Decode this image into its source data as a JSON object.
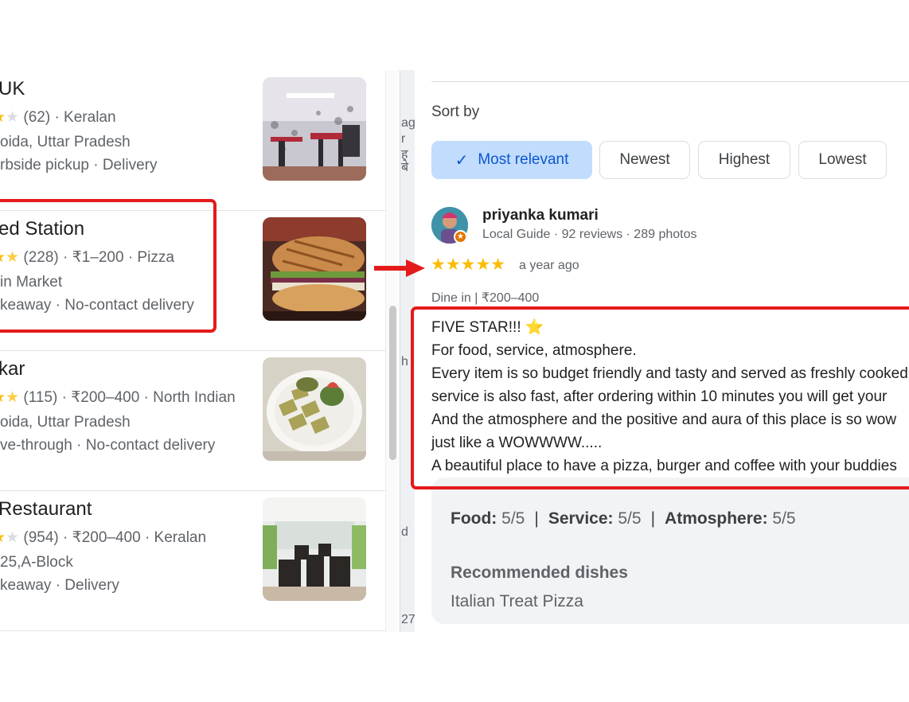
{
  "results": [
    {
      "name": "UK",
      "stars": [
        1,
        0.4,
        0
      ],
      "rating_count": "(62)",
      "meta_rest": " · Keralan",
      "address": "oida, Uttar Pradesh",
      "services": "rbside pickup · Delivery"
    },
    {
      "name": "ed Station",
      "stars": [
        1,
        0.6
      ],
      "rating_count": "(228)",
      "meta_rest": " · ₹1–200 · Pizza",
      "address": "in Market",
      "services": "keaway · No-contact delivery"
    },
    {
      "name": "kar",
      "stars": [
        1,
        0.6
      ],
      "rating_count": "(115)",
      "meta_rest": " · ₹200–400 · North Indian",
      "address": "oida, Uttar Pradesh",
      "services": "ve-through · No-contact delivery"
    },
    {
      "name": "Restaurant",
      "stars": [
        1,
        0.4,
        0
      ],
      "rating_count": "(954)",
      "meta_rest": " · ₹200–400 · Keralan",
      "address": "25,A-Block",
      "services": "keaway · Delivery"
    }
  ],
  "map_strip_text": [
    "ag",
    "r",
    "ह",
    "बे",
    "h",
    "d",
    "27"
  ],
  "review_panel": {
    "sort_label": "Sort by",
    "sort_options": [
      "Most relevant",
      "Newest",
      "Highest",
      "Lowest"
    ],
    "active_sort": "Most relevant",
    "reviewer": {
      "name": "priyanka kumari",
      "meta": "Local Guide · 92 reviews · 289 photos"
    },
    "stars": "★★★★★",
    "time": "a year ago",
    "dine_info": "Dine in  |  ₹200–400",
    "text_lines": [
      "FIVE STAR!!! ⭐",
      "For food, service, atmosphere.",
      "Every item is so budget friendly and tasty and served as freshly cooked",
      "service is also fast, after ordering within 10 minutes you will get your",
      "And the atmosphere and the positive and aura of this place is so wow",
      "just like a WOWWWW.....",
      "A beautiful place to have a pizza, burger and coffee with your buddies"
    ],
    "ratings": {
      "food_label": "Food:",
      "food_value": " 5/5",
      "service_label": "Service:",
      "service_value": " 5/5",
      "atmosphere_label": "Atmosphere:",
      "atmosphere_value": " 5/5",
      "separator": "|"
    },
    "recommended_label": "Recommended dishes",
    "recommended_value": "Italian Treat Pizza"
  },
  "colors": {
    "highlight": "#e41b1b",
    "star": "#fbbc04",
    "active_chip": "#c2dcfd"
  }
}
